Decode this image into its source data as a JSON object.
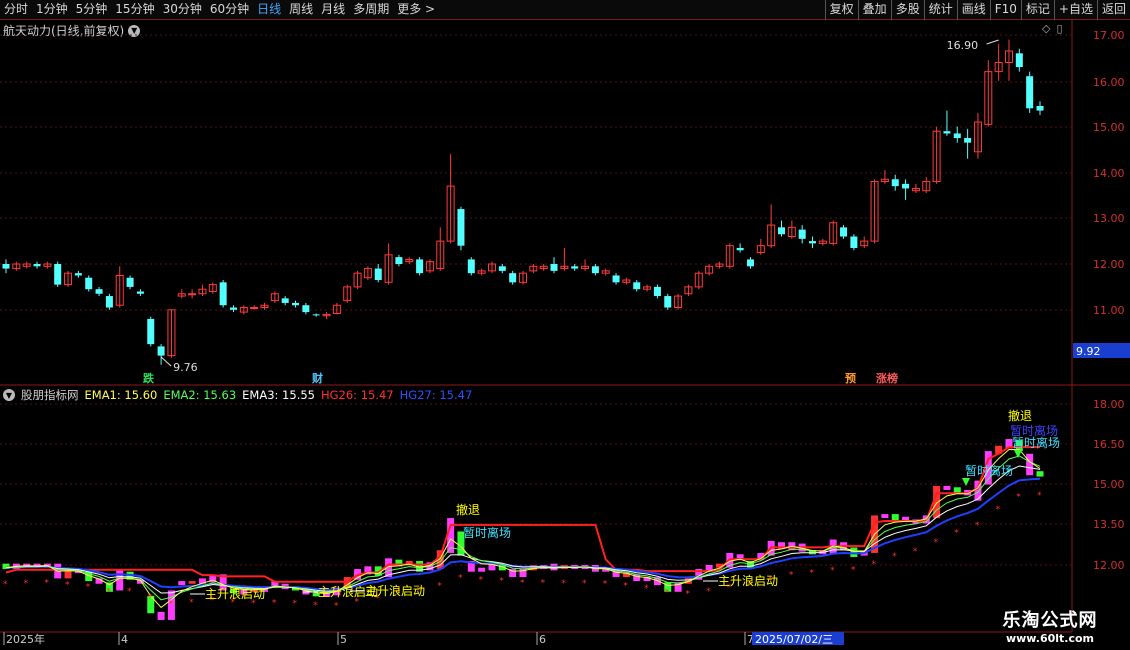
{
  "toolbar": {
    "left_tabs": [
      "分时",
      "1分钟",
      "5分钟",
      "15分钟",
      "30分钟",
      "60分钟",
      "日线",
      "周线",
      "月线",
      "多周期",
      "更多 >"
    ],
    "active_tab": "日线",
    "right_buttons": [
      "复权",
      "叠加",
      "多股",
      "统计",
      "画线",
      "F10",
      "标记",
      "+自选",
      "返回"
    ]
  },
  "main_panel": {
    "title": "航天动力(日线,前复权)",
    "high_label": "16.90",
    "low_label": "9.76",
    "price_axis": [
      "17.00",
      "16.00",
      "15.00",
      "14.00",
      "13.00",
      "12.00",
      "11.00"
    ],
    "current_price_tag": "9.92",
    "markers": [
      {
        "text": "跌",
        "color": "#2fe05c"
      },
      {
        "text": "财",
        "color": "#4fc8ff"
      },
      {
        "text": "预",
        "color": "#ff9a2a"
      },
      {
        "text": "涨榜",
        "color": "#ff5a5a"
      }
    ]
  },
  "indicator_panel": {
    "name": "股朋指标网",
    "ema1": "EMA1: 15.60",
    "ema2": "EMA2: 15.63",
    "ema3": "EMA3: 15.55",
    "hg26": "HG26: 15.47",
    "hg27": "HG27: 15.47",
    "colors": {
      "ema1": "#ffff55",
      "ema2": "#55ff55",
      "ema3": "#ffffff",
      "hg26": "#ff3030",
      "hg27": "#3050ff"
    },
    "axis": [
      "18.00",
      "16.50",
      "15.00",
      "13.50",
      "12.00"
    ],
    "signals": [
      {
        "text": "主升浪启动",
        "color": "#ffff00"
      },
      {
        "text": "主升浪启动",
        "color": "#ffff00"
      },
      {
        "text": "主升浪启动",
        "color": "#ffff00"
      },
      {
        "text": "主升浪启动",
        "color": "#ffff00"
      },
      {
        "text": "撤退",
        "color": "#ffff00"
      },
      {
        "text": "暂时离场",
        "color": "#40e0ff"
      },
      {
        "text": "暂时离场",
        "color": "#40e0ff"
      },
      {
        "text": "撤退",
        "color": "#ffff00"
      },
      {
        "text": "暂时离场",
        "color": "#4040ff"
      },
      {
        "text": "暂时离场",
        "color": "#40e0ff"
      }
    ]
  },
  "date_axis": {
    "labels": [
      "2025年",
      "4",
      "5",
      "6",
      "7"
    ],
    "cursor_date": "2025/07/02/三"
  },
  "watermark": {
    "title": "乐淘公式网",
    "url": "www.60lt.com"
  }
}
